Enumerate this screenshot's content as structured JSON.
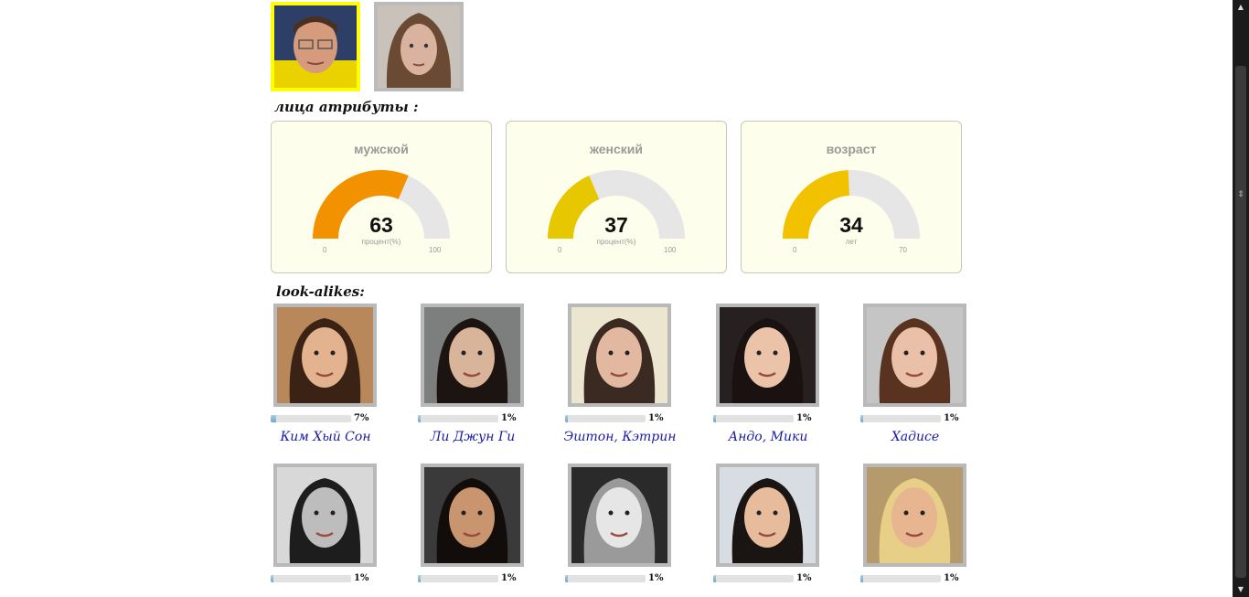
{
  "faces": [
    {
      "label": "",
      "selected": true
    },
    {
      "label": "",
      "selected": false
    }
  ],
  "attributes_title": "лица атрибуты :",
  "gauges": [
    {
      "title": "мужской",
      "value": 63,
      "min": "0",
      "max": "100",
      "unit": "процент(%)",
      "fraction": 0.63,
      "color": "#f39200"
    },
    {
      "title": "женский",
      "value": 37,
      "min": "0",
      "max": "100",
      "unit": "процент(%)",
      "fraction": 0.37,
      "color": "#e6c700"
    },
    {
      "title": "возраст",
      "value": 34,
      "min": "0",
      "max": "70",
      "unit": "лет",
      "fraction": 0.486,
      "color": "#f2c200"
    }
  ],
  "lookalikes_title": "look-alikes:",
  "lookalikes": [
    {
      "name": "Ким Хый Сон",
      "percent": "7%",
      "fraction": 0.07
    },
    {
      "name": "Ли Джун Ги",
      "percent": "1%",
      "fraction": 0.01
    },
    {
      "name": "Эштон, Кэтрин",
      "percent": "1%",
      "fraction": 0.01
    },
    {
      "name": "Андо, Мики",
      "percent": "1%",
      "fraction": 0.01
    },
    {
      "name": "Хадисе",
      "percent": "1%",
      "fraction": 0.01
    },
    {
      "name": "",
      "percent": "1%",
      "fraction": 0.01
    },
    {
      "name": "",
      "percent": "1%",
      "fraction": 0.01
    },
    {
      "name": "",
      "percent": "1%",
      "fraction": 0.01
    },
    {
      "name": "",
      "percent": "1%",
      "fraction": 0.01
    },
    {
      "name": "",
      "percent": "1%",
      "fraction": 0.01
    }
  ],
  "colors": {
    "gauge_track": "#e6e6e6",
    "selected_border": "#ffff00",
    "link": "#1a1aa6"
  }
}
